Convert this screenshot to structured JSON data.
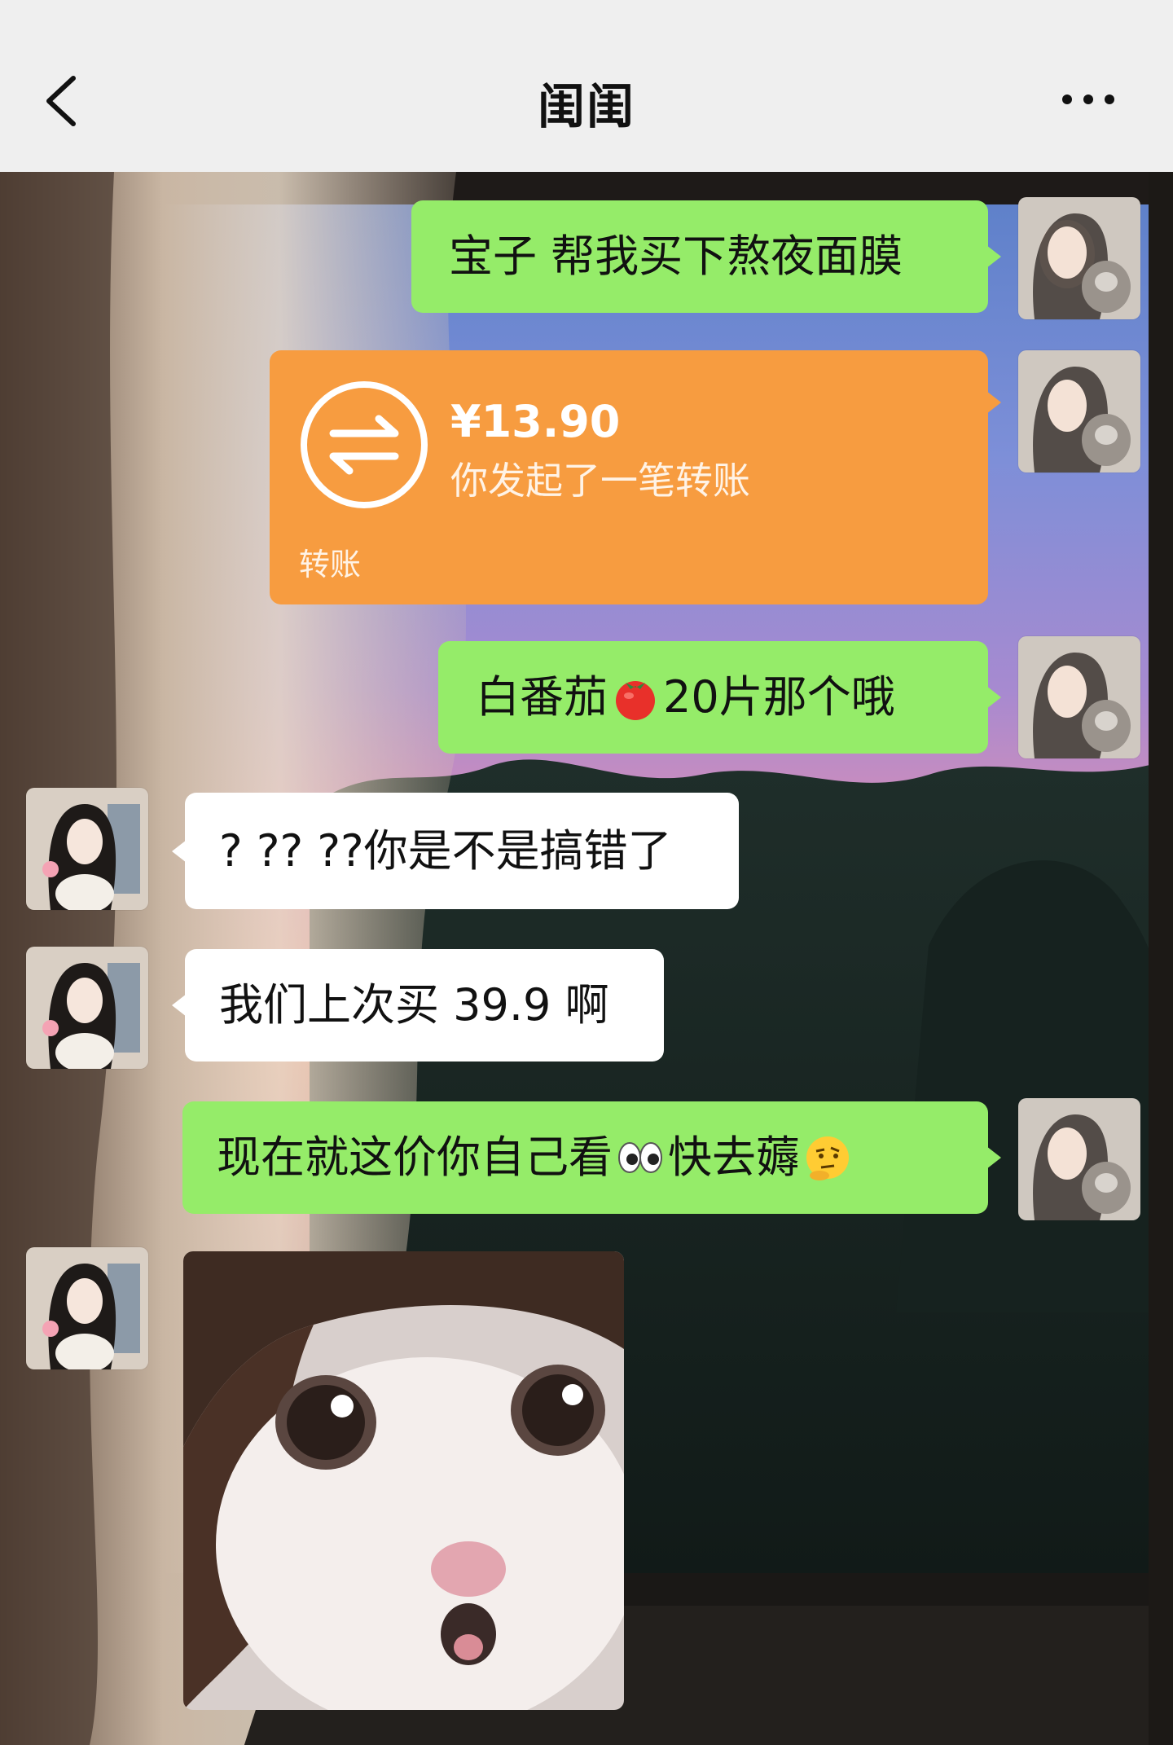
{
  "header": {
    "title": "闺闺",
    "back_icon": "chevron-left-icon",
    "more_icon": "more-dots-icon"
  },
  "messages": [
    {
      "side": "right",
      "type": "text",
      "text": "宝子 帮我买下熬夜面膜"
    },
    {
      "side": "right",
      "type": "transfer",
      "amount": "¥13.90",
      "description": "你发起了一笔转账",
      "label": "转账",
      "icon": "transfer-arrows-icon",
      "color": "#f79c40"
    },
    {
      "side": "right",
      "type": "text",
      "text_before": "白番茄",
      "emoji": "tomato-emoji",
      "text_after": " 20片那个哦"
    },
    {
      "side": "left",
      "type": "text",
      "text": "? ?? ??你是不是搞错了"
    },
    {
      "side": "left",
      "type": "text",
      "text": "我们上次买 39.9 啊"
    },
    {
      "side": "right",
      "type": "text",
      "text_before": "现在就这价你自己看",
      "emoji1": "eyes-emoji",
      "text_middle": "快去薅",
      "emoji2": "thinking-emoji"
    },
    {
      "side": "left",
      "type": "sticker",
      "sticker": "surprised-cat-sticker"
    }
  ],
  "colors": {
    "header_bg": "#efefef",
    "self_bubble": "#95ec69",
    "other_bubble": "#ffffff",
    "transfer_card": "#f79c40"
  }
}
